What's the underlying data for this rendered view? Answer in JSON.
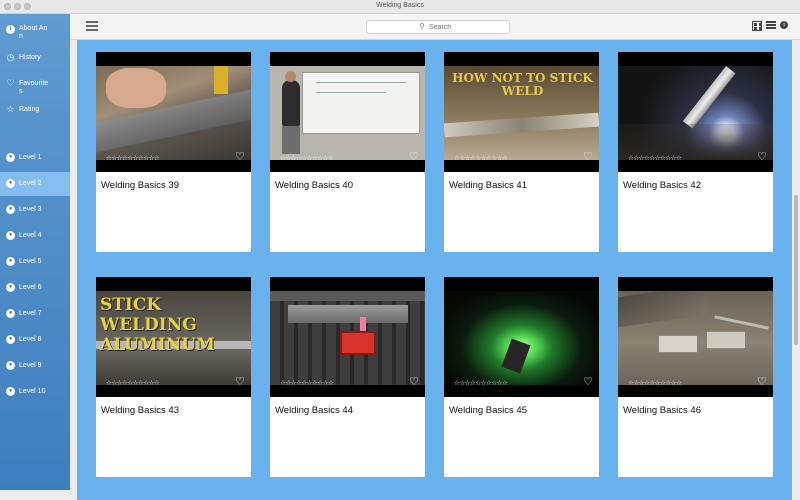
{
  "window": {
    "title": "Welding Basics"
  },
  "sidebar": {
    "items": [
      {
        "label": "About Ann",
        "icon": "info-icon"
      },
      {
        "label": "History",
        "icon": "clock-icon"
      },
      {
        "label": "Favourites",
        "icon": "heart-icon"
      },
      {
        "label": "Rating",
        "icon": "star-icon"
      },
      {
        "label": "Level 1",
        "icon": "level-icon"
      },
      {
        "label": "Level 2",
        "icon": "level-icon",
        "active": true
      },
      {
        "label": "Level 3",
        "icon": "level-icon"
      },
      {
        "label": "Level 4",
        "icon": "level-icon"
      },
      {
        "label": "Level 5",
        "icon": "level-icon"
      },
      {
        "label": "Level 6",
        "icon": "level-icon"
      },
      {
        "label": "Level 7",
        "icon": "level-icon"
      },
      {
        "label": "Level 8",
        "icon": "level-icon"
      },
      {
        "label": "Level 9",
        "icon": "level-icon"
      },
      {
        "label": "Level 10",
        "icon": "level-icon"
      }
    ]
  },
  "toolbar": {
    "search_placeholder": "Search",
    "icons": [
      "menu-icon",
      "search-icon",
      "grid-view-icon",
      "list-view-icon",
      "info-icon"
    ]
  },
  "videos": [
    {
      "title": "Welding Basics 39",
      "stars": "☆☆☆☆☆☆☆☆☆☆",
      "thumb_text": ""
    },
    {
      "title": "Welding Basics 40",
      "stars": "☆☆☆☆☆☆☆☆☆☆",
      "thumb_text": ""
    },
    {
      "title": "Welding Basics 41",
      "stars": "☆☆☆☆☆☆☆☆☆☆",
      "thumb_text": "HOW NOT TO STICK WELD"
    },
    {
      "title": "Welding Basics 42",
      "stars": "☆☆☆☆☆☆☆☆☆☆",
      "thumb_text": ""
    },
    {
      "title": "Welding Basics 43",
      "stars": "☆☆☆☆☆☆☆☆☆☆",
      "thumb_text": "STICK WELDING ALUMINUM"
    },
    {
      "title": "Welding Basics 44",
      "stars": "☆☆☆☆☆☆☆☆☆☆",
      "thumb_text": ""
    },
    {
      "title": "Welding Basics 45",
      "stars": "☆☆☆☆☆☆☆☆☆☆",
      "thumb_text": ""
    },
    {
      "title": "Welding Basics 46",
      "stars": "☆☆☆☆☆☆☆☆☆☆",
      "thumb_text": ""
    }
  ],
  "colors": {
    "sidebar": "#4f8dc8",
    "sidebar_active": "#86bdf0",
    "content_bg": "#6ab2ee"
  }
}
